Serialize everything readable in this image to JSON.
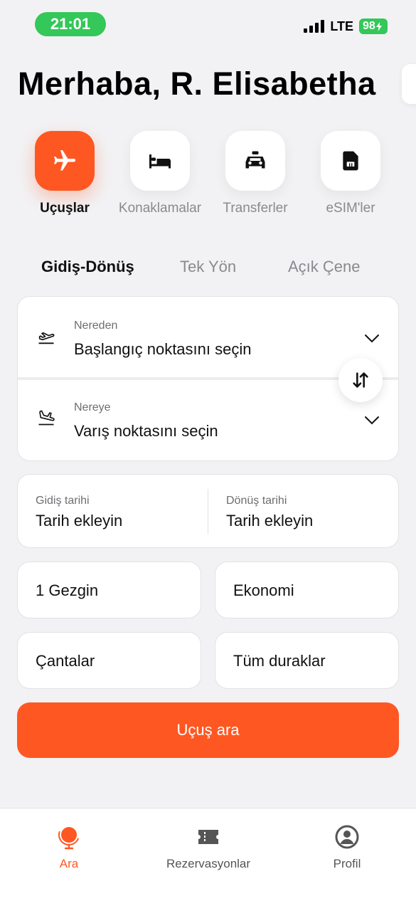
{
  "status_bar": {
    "time": "21:01",
    "network": "LTE",
    "battery": "98"
  },
  "greeting": "Merhaba, R. Elisabetha",
  "categories": [
    {
      "label": "Uçuşlar",
      "icon": "airplane-icon",
      "active": true
    },
    {
      "label": "Konaklamalar",
      "icon": "bed-icon",
      "active": false
    },
    {
      "label": "Transferler",
      "icon": "taxi-icon",
      "active": false
    },
    {
      "label": "eSIM'ler",
      "icon": "sim-card-icon",
      "active": false
    }
  ],
  "trip_types": [
    {
      "label": "Gidiş-Dönüş",
      "active": true
    },
    {
      "label": "Tek Yön",
      "active": false
    },
    {
      "label": "Açık Çene",
      "active": false
    }
  ],
  "route": {
    "from": {
      "label": "Nereden",
      "placeholder": "Başlangıç noktasını seçin",
      "icon": "takeoff-icon"
    },
    "to": {
      "label": "Nereye",
      "placeholder": "Varış noktasını seçin",
      "icon": "landing-icon"
    }
  },
  "dates": {
    "departure": {
      "label": "Gidiş tarihi",
      "value": "Tarih ekleyin"
    },
    "return": {
      "label": "Dönüş tarihi",
      "value": "Tarih ekleyin"
    }
  },
  "options": {
    "travelers": "1 Gezgin",
    "cabin": "Ekonomi",
    "bags": "Çantalar",
    "stops": "Tüm duraklar"
  },
  "search_button": "Uçuş ara",
  "bottom_nav": [
    {
      "label": "Ara",
      "icon": "globe-icon",
      "active": true
    },
    {
      "label": "Rezervasyonlar",
      "icon": "ticket-icon",
      "active": false
    },
    {
      "label": "Profil",
      "icon": "profile-icon",
      "active": false
    }
  ],
  "colors": {
    "accent": "#ff5722",
    "status_green": "#34c759",
    "background": "#f2f2f4"
  }
}
